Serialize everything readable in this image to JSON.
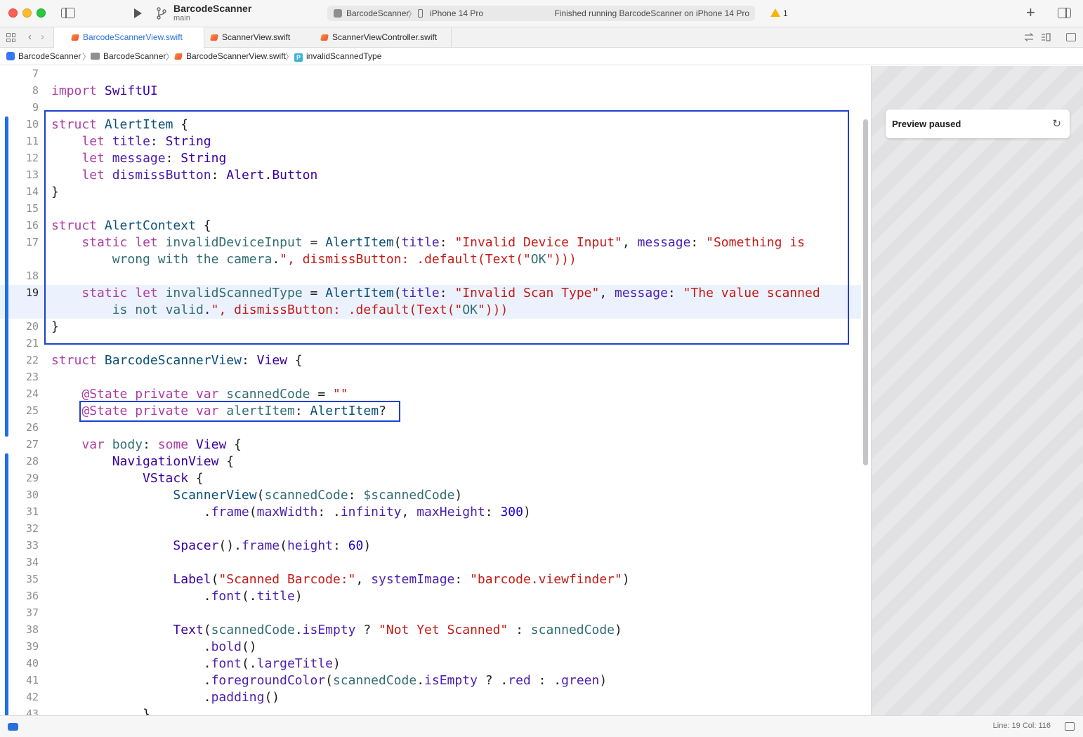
{
  "titlebar": {
    "project_name": "BarcodeScanner",
    "branch": "main",
    "activity": {
      "scheme": "BarcodeScanner",
      "device": "iPhone 14 Pro",
      "status": "Finished running BarcodeScanner on iPhone 14 Pro"
    },
    "warning_count": "1"
  },
  "tabs": [
    {
      "label": "BarcodeScannerView.swift",
      "active": true
    },
    {
      "label": "ScannerView.swift",
      "active": false
    },
    {
      "label": "ScannerViewController.swift",
      "active": false
    }
  ],
  "jumpbar": [
    "BarcodeScanner",
    "BarcodeScanner",
    "BarcodeScannerView.swift",
    "invalidScannedType"
  ],
  "editor": {
    "current_line": 19,
    "lines": [
      {
        "n": "7",
        "text": ""
      },
      {
        "n": "8",
        "text": "import SwiftUI"
      },
      {
        "n": "9",
        "text": ""
      },
      {
        "n": "10",
        "text": "struct AlertItem {"
      },
      {
        "n": "11",
        "text": "    let title: String"
      },
      {
        "n": "12",
        "text": "    let message: String"
      },
      {
        "n": "13",
        "text": "    let dismissButton: Alert.Button"
      },
      {
        "n": "14",
        "text": "}"
      },
      {
        "n": "15",
        "text": ""
      },
      {
        "n": "16",
        "text": "struct AlertContext {"
      },
      {
        "n": "17",
        "text": "    static let invalidDeviceInput = AlertItem(title: \"Invalid Device Input\", message: \"Something is\n        wrong with the camera.\", dismissButton: .default(Text(\"OK\")))"
      },
      {
        "n": "18",
        "text": ""
      },
      {
        "n": "19",
        "text": "    static let invalidScannedType = AlertItem(title: \"Invalid Scan Type\", message: \"The value scanned\n        is not valid.\", dismissButton: .default(Text(\"OK\")))"
      },
      {
        "n": "20",
        "text": "}"
      },
      {
        "n": "21",
        "text": ""
      },
      {
        "n": "22",
        "text": "struct BarcodeScannerView: View {"
      },
      {
        "n": "23",
        "text": ""
      },
      {
        "n": "24",
        "text": "    @State private var scannedCode = \"\""
      },
      {
        "n": "25",
        "text": "    @State private var alertItem: AlertItem?"
      },
      {
        "n": "26",
        "text": ""
      },
      {
        "n": "27",
        "text": "    var body: some View {"
      },
      {
        "n": "28",
        "text": "        NavigationView {"
      },
      {
        "n": "29",
        "text": "            VStack {"
      },
      {
        "n": "30",
        "text": "                ScannerView(scannedCode: $scannedCode)"
      },
      {
        "n": "31",
        "text": "                    .frame(maxWidth: .infinity, maxHeight: 300)"
      },
      {
        "n": "32",
        "text": ""
      },
      {
        "n": "33",
        "text": "                Spacer().frame(height: 60)"
      },
      {
        "n": "34",
        "text": ""
      },
      {
        "n": "35",
        "text": "                Label(\"Scanned Barcode:\", systemImage: \"barcode.viewfinder\")"
      },
      {
        "n": "36",
        "text": "                    .font(.title)"
      },
      {
        "n": "37",
        "text": ""
      },
      {
        "n": "38",
        "text": "                Text(scannedCode.isEmpty ? \"Not Yet Scanned\" : scannedCode)"
      },
      {
        "n": "39",
        "text": "                    .bold()"
      },
      {
        "n": "40",
        "text": "                    .font(.largeTitle)"
      },
      {
        "n": "41",
        "text": "                    .foregroundColor(scannedCode.isEmpty ? .red : .green)"
      },
      {
        "n": "42",
        "text": "                    .padding()"
      },
      {
        "n": "43",
        "text": "            }"
      }
    ]
  },
  "canvas": {
    "preview_status": "Preview paused"
  },
  "statusbar": {
    "cursor": "Line: 19  Col: 116"
  },
  "colors": {
    "keyword": "#ad3da4",
    "type": "#0b4f79",
    "string": "#c41a16",
    "number": "#1c00cf",
    "accent": "#2a6fdb",
    "highlight_box": "#1f3fd1"
  }
}
